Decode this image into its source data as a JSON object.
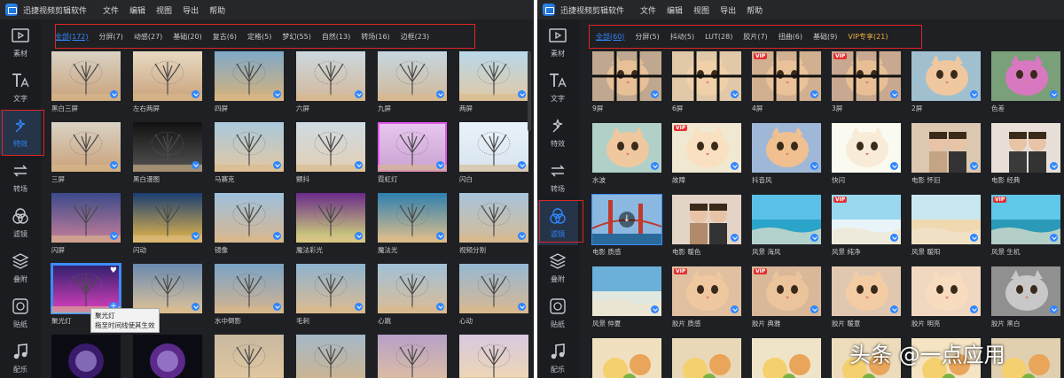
{
  "app": {
    "title": "迅捷视频剪辑软件",
    "menu": [
      "文件",
      "编辑",
      "视图",
      "导出",
      "帮助"
    ]
  },
  "sidebar": [
    {
      "label": "素材",
      "icon": "media-icon"
    },
    {
      "label": "文字",
      "icon": "text-icon"
    },
    {
      "label": "特效",
      "icon": "effects-icon"
    },
    {
      "label": "转场",
      "icon": "transition-icon"
    },
    {
      "label": "滤镜",
      "icon": "filter-icon"
    },
    {
      "label": "叠附",
      "icon": "overlay-icon"
    },
    {
      "label": "贴纸",
      "icon": "sticker-icon"
    },
    {
      "label": "配乐",
      "icon": "music-icon"
    }
  ],
  "left_panel": {
    "active_sidebar": "特效",
    "tabs": [
      "全部(172)",
      "分屏(7)",
      "动感(27)",
      "基础(20)",
      "复古(6)",
      "定格(5)",
      "梦幻(55)",
      "自然(13)",
      "转场(16)",
      "边框(23)"
    ],
    "items": [
      "黑白三屏",
      "左右两屏",
      "四屏",
      "六屏",
      "九屏",
      "两屏",
      "三屏",
      "黑白漫图",
      "马赛克",
      "颤抖",
      "霓虹灯",
      "闪白",
      "闪屏",
      "闪动",
      "镜像",
      "魔法彩光",
      "魔法光",
      "视频分割",
      "聚光灯",
      "",
      "水中倒影",
      "毛刺",
      "心跳",
      "心动",
      "",
      "",
      "",
      "",
      "",
      ""
    ],
    "tooltip": {
      "title": "聚光灯",
      "hint": "拖至时间线使其生效"
    }
  },
  "right_panel": {
    "active_sidebar": "滤镜",
    "tabs": [
      "全部(60)",
      "分屏(5)",
      "抖动(5)",
      "LUT(28)",
      "胶片(7)",
      "扭曲(6)",
      "基础(9)",
      "VIP专享(21)"
    ],
    "items": [
      "9屏",
      "6屏",
      "4屏",
      "3屏",
      "2屏",
      "色差",
      "水波",
      "故障",
      "抖音风",
      "快闪",
      "电影 怀旧",
      "电影 经典",
      "电影 质感",
      "电影 暖色",
      "风景 海风",
      "风景 纯净",
      "风景 暖阳",
      "风景 生机",
      "风景 仲夏",
      "胶片 质感",
      "胶片 典雅",
      "胶片 暖意",
      "胶片 明亮",
      "胶片 黑白",
      "",
      "",
      "",
      "",
      "",
      ""
    ],
    "vip_badge": "VIP"
  },
  "watermark": "头条 @一点应用",
  "colors": {
    "accent": "#2f86ff",
    "highlight_box": "#e02424",
    "vip": "#e8b13b",
    "background": "#1f2023"
  }
}
